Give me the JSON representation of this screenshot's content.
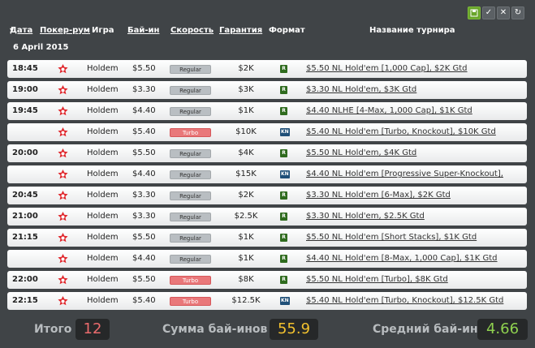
{
  "toolbar": {
    "save_icon": "floppy-disk-icon",
    "check_icon": "checkmark-icon",
    "close_icon": "close-icon",
    "refresh_icon": "refresh-icon"
  },
  "header": {
    "date": "Дата",
    "room": "Покер-рум",
    "game": "Игра",
    "buyin": "Бай-ин",
    "speed": "Скорость",
    "guarantee": "Гарантия",
    "format": "Формат",
    "name": "Название турнира"
  },
  "date_label": "6 April 2015",
  "rows": [
    {
      "time": "18:45",
      "game": "Holdem",
      "buyin": "$5.50",
      "speed": "Regular",
      "gtd": "$2K",
      "format": "R",
      "name": "$5.50 NL Hold'em [1,000 Cap], $2K Gtd"
    },
    {
      "time": "19:00",
      "game": "Holdem",
      "buyin": "$3.30",
      "speed": "Regular",
      "gtd": "$3K",
      "format": "R",
      "name": "$3.30 NL Hold'em, $3K Gtd"
    },
    {
      "time": "19:45",
      "game": "Holdem",
      "buyin": "$4.40",
      "speed": "Regular",
      "gtd": "$1K",
      "format": "R",
      "name": "$4.40 NLHE [4-Max, 1,000 Cap], $1K Gtd"
    },
    {
      "time": "",
      "game": "Holdem",
      "buyin": "$5.40",
      "speed": "Turbo",
      "gtd": "$10K",
      "format": "KN",
      "name": "$5.40 NL Hold'em [Turbo, Knockout], $10K Gtd"
    },
    {
      "time": "20:00",
      "game": "Holdem",
      "buyin": "$5.50",
      "speed": "Regular",
      "gtd": "$4K",
      "format": "R",
      "name": "$5.50 NL Hold'em, $4K Gtd"
    },
    {
      "time": "",
      "game": "Holdem",
      "buyin": "$4.40",
      "speed": "Regular",
      "gtd": "$15K",
      "format": "KN",
      "name": "$4.40 NL Hold'em [Progressive Super-Knockout],"
    },
    {
      "time": "20:45",
      "game": "Holdem",
      "buyin": "$3.30",
      "speed": "Regular",
      "gtd": "$2K",
      "format": "R",
      "name": "$3.30 NL Hold'em [6-Max], $2K Gtd"
    },
    {
      "time": "21:00",
      "game": "Holdem",
      "buyin": "$3.30",
      "speed": "Regular",
      "gtd": "$2.5K",
      "format": "R",
      "name": "$3.30 NL Hold'em, $2.5K Gtd"
    },
    {
      "time": "21:15",
      "game": "Holdem",
      "buyin": "$5.50",
      "speed": "Regular",
      "gtd": "$1K",
      "format": "R",
      "name": "$5.50 NL Hold'em [Short Stacks], $1K Gtd"
    },
    {
      "time": "",
      "game": "Holdem",
      "buyin": "$4.40",
      "speed": "Regular",
      "gtd": "$1K",
      "format": "R",
      "name": "$4.40 NL Hold'em [8-Max, 1,000 Cap], $1K Gtd"
    },
    {
      "time": "22:00",
      "game": "Holdem",
      "buyin": "$5.50",
      "speed": "Turbo",
      "gtd": "$8K",
      "format": "R",
      "name": "$5.50 NL Hold'em [Turbo], $8K Gtd"
    },
    {
      "time": "22:15",
      "game": "Holdem",
      "buyin": "$5.40",
      "speed": "Turbo",
      "gtd": "$12.5K",
      "format": "KN",
      "name": "$5.40 NL Hold'em [Turbo, Knockout], $12.5K Gtd"
    }
  ],
  "footer": {
    "total_label": "Итого",
    "total_value": "12",
    "sum_label": "Сумма бай-инов",
    "sum_value": "55.9",
    "avg_label": "Средний бай-ин",
    "avg_value": "4.66"
  },
  "colors": {
    "background": "#404447",
    "turbo": "#e9787a",
    "regular": "#b9bec2",
    "total": "#ea6b6d",
    "sum": "#f2c12e",
    "avg": "#8fd14f",
    "pokerstars": "#e0262b"
  }
}
